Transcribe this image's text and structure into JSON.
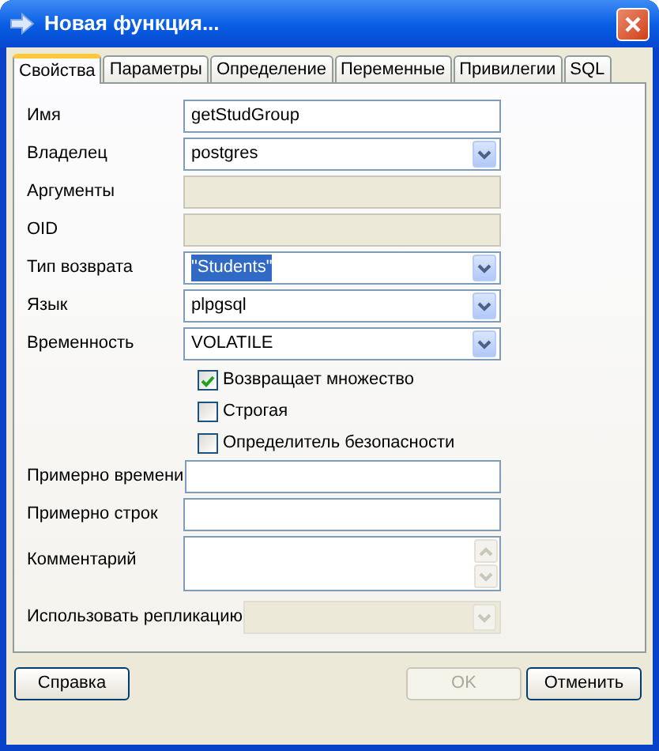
{
  "window": {
    "title": "Новая функция..."
  },
  "tabs": [
    {
      "label": "Свойства",
      "selected": true
    },
    {
      "label": "Параметры",
      "selected": false
    },
    {
      "label": "Определение",
      "selected": false
    },
    {
      "label": "Переменные",
      "selected": false
    },
    {
      "label": "Привилегии",
      "selected": false
    },
    {
      "label": "SQL",
      "selected": false
    }
  ],
  "rows": [
    {
      "kind": "text",
      "label": "Имя",
      "value": "getStudGroup",
      "disabled": false
    },
    {
      "kind": "dropdown",
      "label": "Владелец",
      "value": "postgres",
      "disabled": false
    },
    {
      "kind": "text",
      "label": "Аргументы",
      "disabled": true
    },
    {
      "kind": "text",
      "label": "OID",
      "disabled": true
    },
    {
      "kind": "dropdown",
      "label": "Тип возврата",
      "value": "\"Students\"",
      "disabled": false,
      "highlighted": true
    },
    {
      "kind": "dropdown",
      "label": "Язык",
      "value": "plpgsql",
      "disabled": false
    },
    {
      "kind": "dropdown",
      "label": "Временность",
      "value": "VOLATILE",
      "disabled": false
    },
    {
      "kind": "checkbox",
      "label": "Возвращает множество",
      "checked": true
    },
    {
      "kind": "checkbox",
      "label": "Строгая",
      "checked": false
    },
    {
      "kind": "checkbox",
      "label": "Определитель безопасности",
      "checked": false
    },
    {
      "kind": "text",
      "label": "Примерно времени",
      "disabled": false
    },
    {
      "kind": "text",
      "label": "Примерно строк",
      "disabled": false
    },
    {
      "kind": "memo",
      "label": "Комментарий",
      "disabled": false
    },
    {
      "kind": "dropdown",
      "label": "Использовать репликацию",
      "disabled": true
    }
  ],
  "buttons": [
    {
      "label": "Справка",
      "disabled": false
    },
    {
      "label": "OK",
      "disabled": true
    },
    {
      "label": "Отменить",
      "disabled": false
    }
  ]
}
